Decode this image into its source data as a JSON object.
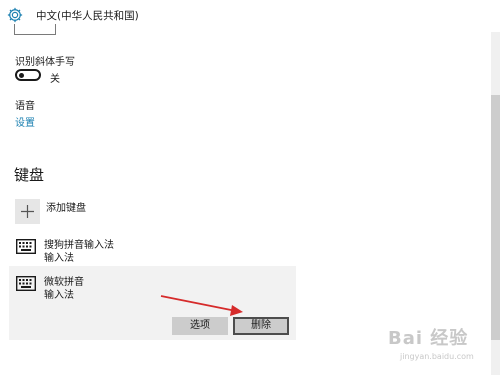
{
  "window": {
    "title": "中文(中华人民共和国)"
  },
  "handwriting": {
    "label": "识别斜体手写",
    "toggle_state": "关"
  },
  "speech": {
    "label": "语音",
    "settings_link": "设置"
  },
  "keyboard_section": {
    "title": "键盘",
    "add_label": "添加键盘",
    "keyboards": [
      {
        "name": "搜狗拼音输入法",
        "type": "输入法"
      },
      {
        "name": "微软拼音",
        "type": "输入法"
      }
    ],
    "options_button": "选项",
    "delete_button": "删除"
  },
  "watermark": {
    "text": "Bai 经验",
    "url": "jingyan.baidu.com"
  },
  "colors": {
    "accent_link": "#1a7fb0",
    "arrow": "#d62b2b"
  }
}
